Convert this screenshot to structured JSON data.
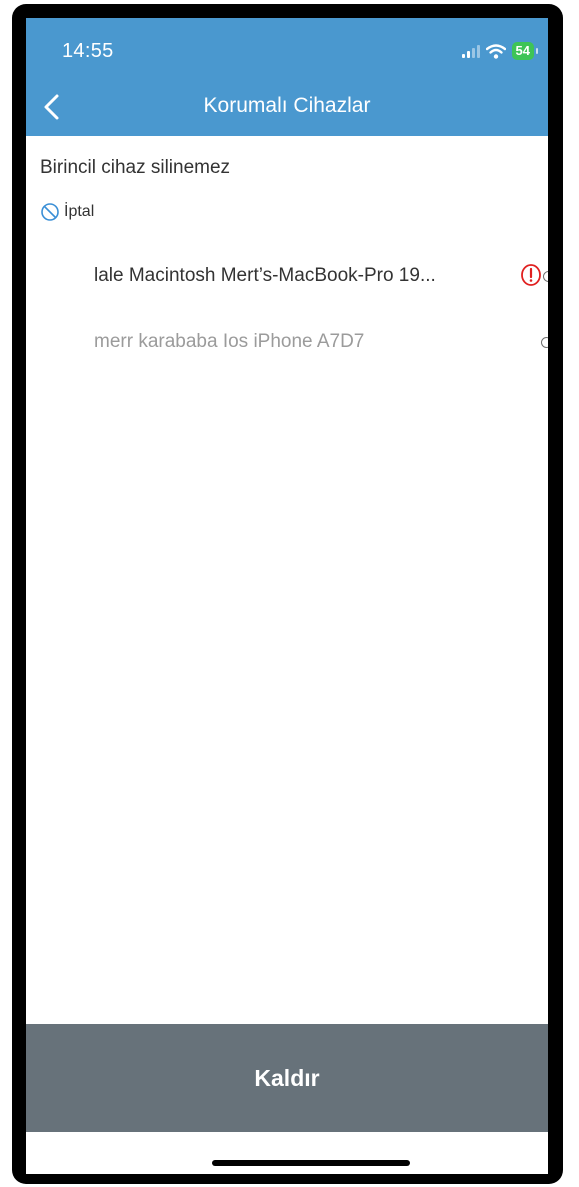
{
  "status_bar": {
    "time": "14:55",
    "battery": "54",
    "icons": [
      "signal-icon",
      "wifi-icon",
      "battery-icon"
    ]
  },
  "nav": {
    "title": "Korumalı Cihazlar",
    "back_icon": "chevron-left-icon"
  },
  "notice": "Birincil cihaz silinemez",
  "cancel": {
    "label": "İptal",
    "icon": "prohibited-icon"
  },
  "devices": [
    {
      "name": "lale  Macintosh Mert’s-MacBook-Pro 19...",
      "warning_icon": "exclamation-circle-icon",
      "selected": false
    },
    {
      "name": "merr karababa Ios iPhone A7D7",
      "selected": false
    }
  ],
  "remove_button": {
    "label": "Kaldır"
  },
  "colors": {
    "header": "#4a98cf",
    "button": "#67727a",
    "warning": "#e02020",
    "cancel_icon": "#3a8fd6",
    "battery": "#3ec457"
  }
}
